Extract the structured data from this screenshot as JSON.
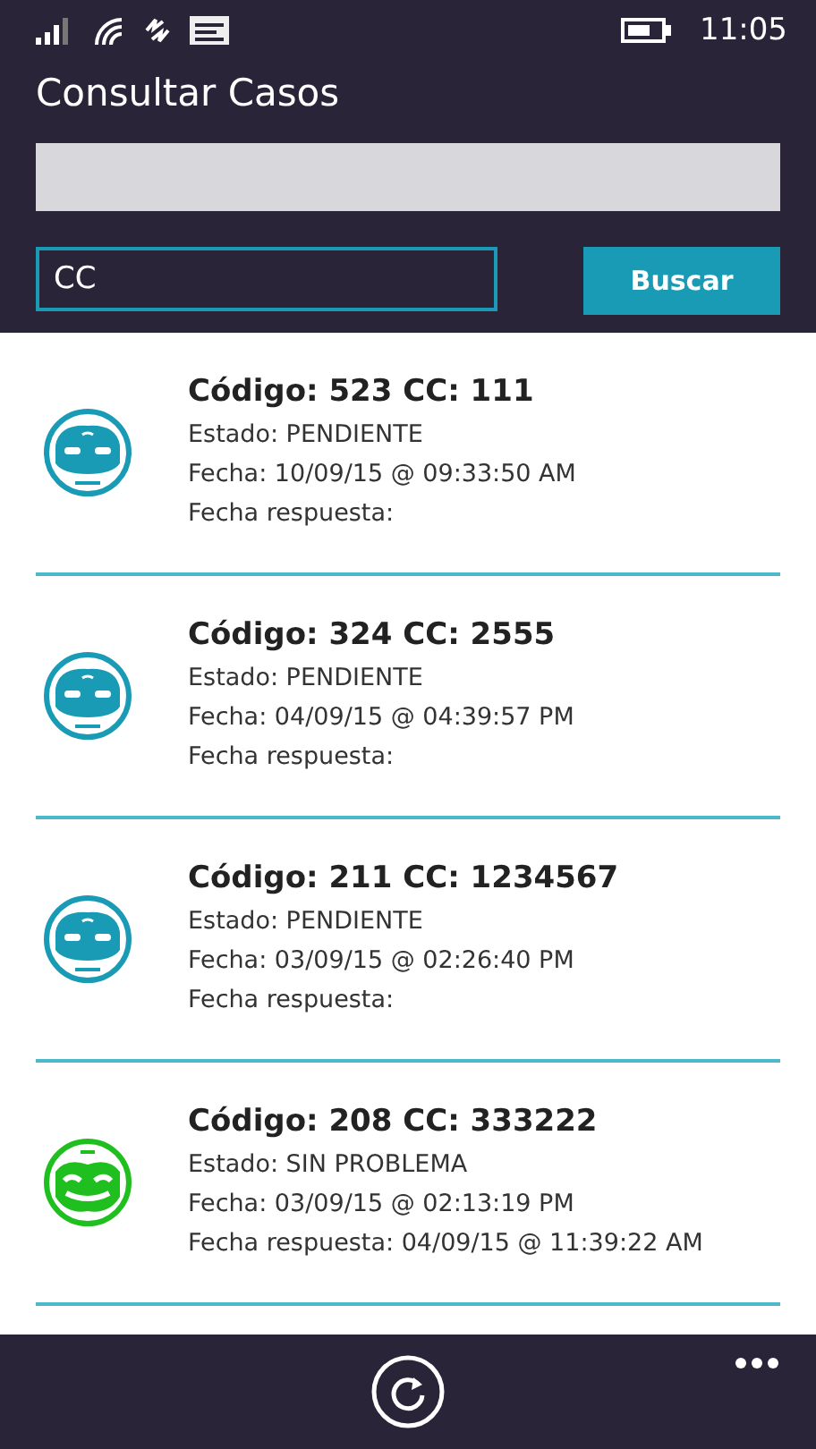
{
  "status_bar": {
    "time": "11:05"
  },
  "page": {
    "title": "Consultar Casos"
  },
  "search": {
    "query_field": {
      "value": "CC"
    },
    "button": "Buscar"
  },
  "cases": [
    {
      "title": "Código: 523 CC: 111",
      "kind": "pending",
      "estado": "Estado: PENDIENTE",
      "fecha": "Fecha: 10/09/15 @ 09:33:50 AM",
      "respuesta": "Fecha respuesta:"
    },
    {
      "title": "Código: 324 CC: 2555",
      "kind": "pending",
      "estado": "Estado: PENDIENTE",
      "fecha": "Fecha: 04/09/15 @ 04:39:57 PM",
      "respuesta": "Fecha respuesta:"
    },
    {
      "title": "Código: 211 CC: 1234567",
      "kind": "pending",
      "estado": "Estado: PENDIENTE",
      "fecha": "Fecha: 03/09/15 @ 02:26:40 PM",
      "respuesta": "Fecha respuesta:"
    },
    {
      "title": "Código: 208 CC: 333222",
      "kind": "resolved",
      "estado": "Estado: SIN PROBLEMA",
      "fecha": "Fecha: 03/09/15 @ 02:13:19 PM",
      "respuesta": "Fecha respuesta: 04/09/15 @ 11:39:22 AM"
    }
  ]
}
